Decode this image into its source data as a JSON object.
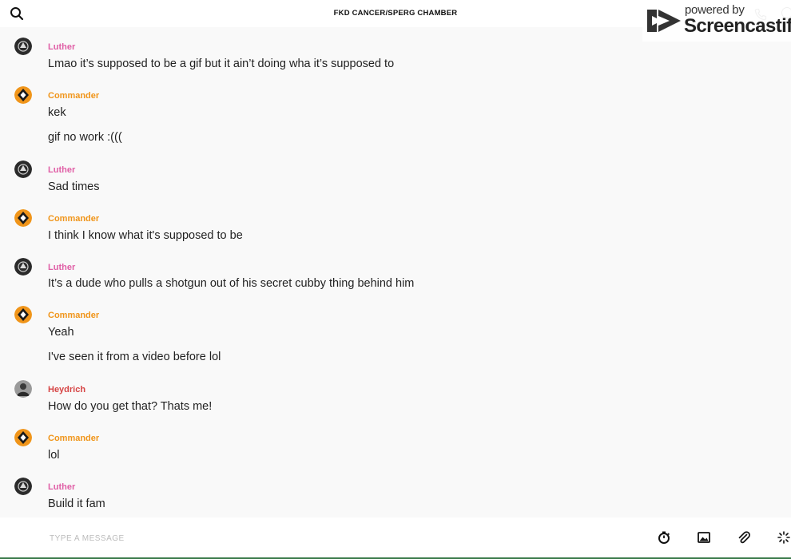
{
  "header": {
    "title": "FKD CANCER/SPERG CHAMBER"
  },
  "watermark": {
    "powered_by": "powered by",
    "brand": "Screencastify"
  },
  "colors": {
    "luther": "#e05fa6",
    "commander": "#f0951a",
    "heydrich": "#d64545"
  },
  "messages": [
    {
      "author": "Luther",
      "avatar": "luther-avatar-icon",
      "lines": [
        "Lmao it’s supposed to be a gif but it ain’t doing wha it’s supposed to"
      ]
    },
    {
      "author": "Commander",
      "avatar": "commander-avatar-icon",
      "lines": [
        "kek",
        "gif no work :((("
      ]
    },
    {
      "author": "Luther",
      "avatar": "luther-avatar-icon",
      "lines": [
        "Sad times"
      ]
    },
    {
      "author": "Commander",
      "avatar": "commander-avatar-icon",
      "lines": [
        "I think I know what it's supposed to be"
      ]
    },
    {
      "author": "Luther",
      "avatar": "luther-avatar-icon",
      "lines": [
        "It’s a dude who pulls a shotgun out of his secret cubby thing behind him"
      ]
    },
    {
      "author": "Commander",
      "avatar": "commander-avatar-icon",
      "lines": [
        "Yeah",
        "I've seen it from a video before lol"
      ]
    },
    {
      "author": "Heydrich",
      "avatar": "heydrich-avatar-icon",
      "lines": [
        "How do you get that? Thats me!"
      ]
    },
    {
      "author": "Commander",
      "avatar": "commander-avatar-icon",
      "lines": [
        "lol"
      ]
    },
    {
      "author": "Luther",
      "avatar": "luther-avatar-icon",
      "lines": [
        "Build it fam"
      ]
    }
  ],
  "composer": {
    "placeholder": "TYPE A MESSAGE",
    "tools": [
      "timer-icon",
      "image-icon",
      "attachment-icon",
      "sparkle-icon"
    ]
  }
}
